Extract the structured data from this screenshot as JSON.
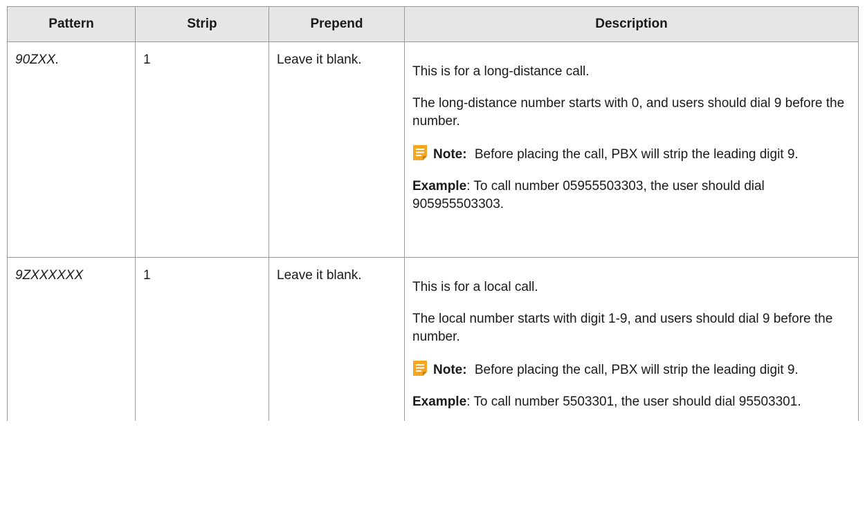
{
  "table": {
    "headers": {
      "pattern": "Pattern",
      "strip": "Strip",
      "prepend": "Prepend",
      "description": "Description"
    },
    "rows": [
      {
        "pattern": "90ZXX.",
        "strip": "1",
        "prepend": "Leave it blank.",
        "desc": {
          "intro": "This is for a long-distance call.",
          "detail": "The long-distance number starts with 0, and users should dial 9 before the number.",
          "note_label": "Note:",
          "note_text": "Before placing the call, PBX will strip the leading digit 9.",
          "example_label": "Example",
          "example_text": ": To call number 05955503303, the user should dial 905955503303."
        }
      },
      {
        "pattern": "9ZXXXXXX",
        "strip": "1",
        "prepend": "Leave it blank.",
        "desc": {
          "intro": "This is for a local call.",
          "detail": "The local number starts with digit 1-9, and users should dial 9 before the number.",
          "note_label": "Note:",
          "note_text": "Before placing the call, PBX will strip the leading digit 9.",
          "example_label": "Example",
          "example_text": ": To call number 5503301, the user should dial 95503301."
        }
      }
    ]
  },
  "colors": {
    "header_bg": "#e6e6e6",
    "border": "#999999",
    "note_icon": "#f5a623"
  },
  "icons": {
    "note": "note-icon"
  }
}
